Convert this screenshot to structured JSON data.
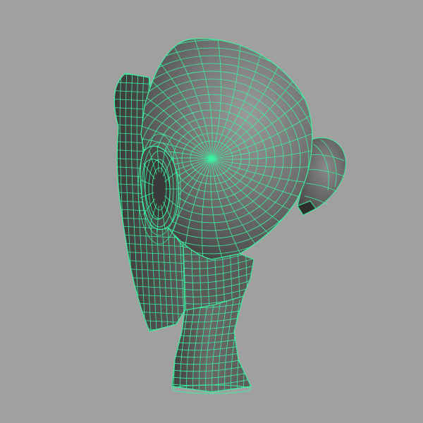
{
  "viewport": {
    "background_color": "#a0a0a0",
    "object": "polygon-head-mesh",
    "display_mode": "wireframe-on-shaded",
    "wire_color": "#3cf0a0",
    "surface_dark": "#3a3a3a",
    "surface_mid": "#6e6e6e",
    "surface_light": "#9a9a9a",
    "selected": true
  }
}
